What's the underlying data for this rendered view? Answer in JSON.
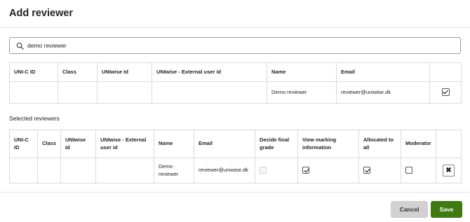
{
  "dialog": {
    "title": "Add reviewer"
  },
  "search": {
    "value": "demo reviewer"
  },
  "results": {
    "headers": [
      "UNI-C ID",
      "Class",
      "UNIwise Id",
      "UNIwise - External user id",
      "Name",
      "Email",
      ""
    ],
    "rows": [
      {
        "unic_id": "",
        "class": "",
        "uniwise_id": "",
        "external_id": "",
        "name": "Demo reviewer",
        "email": "reviewer@uniwise.dk",
        "selected": true
      }
    ]
  },
  "selected": {
    "label": "Selected reviewers",
    "headers": [
      "UNI-C ID",
      "Class",
      "UNIwise Id",
      "UNIwise - External user id",
      "Name",
      "Email",
      "Decide final grade",
      "View marking information",
      "Allocated to all",
      "Moderator",
      ""
    ],
    "rows": [
      {
        "unic_id": "",
        "class": "",
        "uniwise_id": "",
        "external_id": "",
        "name": "Demo reviewer",
        "email": "reviewer@uniwise.dk",
        "decide_final_grade": false,
        "view_marking_information": true,
        "allocated_to_all": true,
        "moderator": false
      }
    ]
  },
  "footer": {
    "cancel_label": "Cancel",
    "save_label": "Save"
  },
  "colors": {
    "save": "#3f7a12",
    "cancel": "#d1d1d1"
  }
}
